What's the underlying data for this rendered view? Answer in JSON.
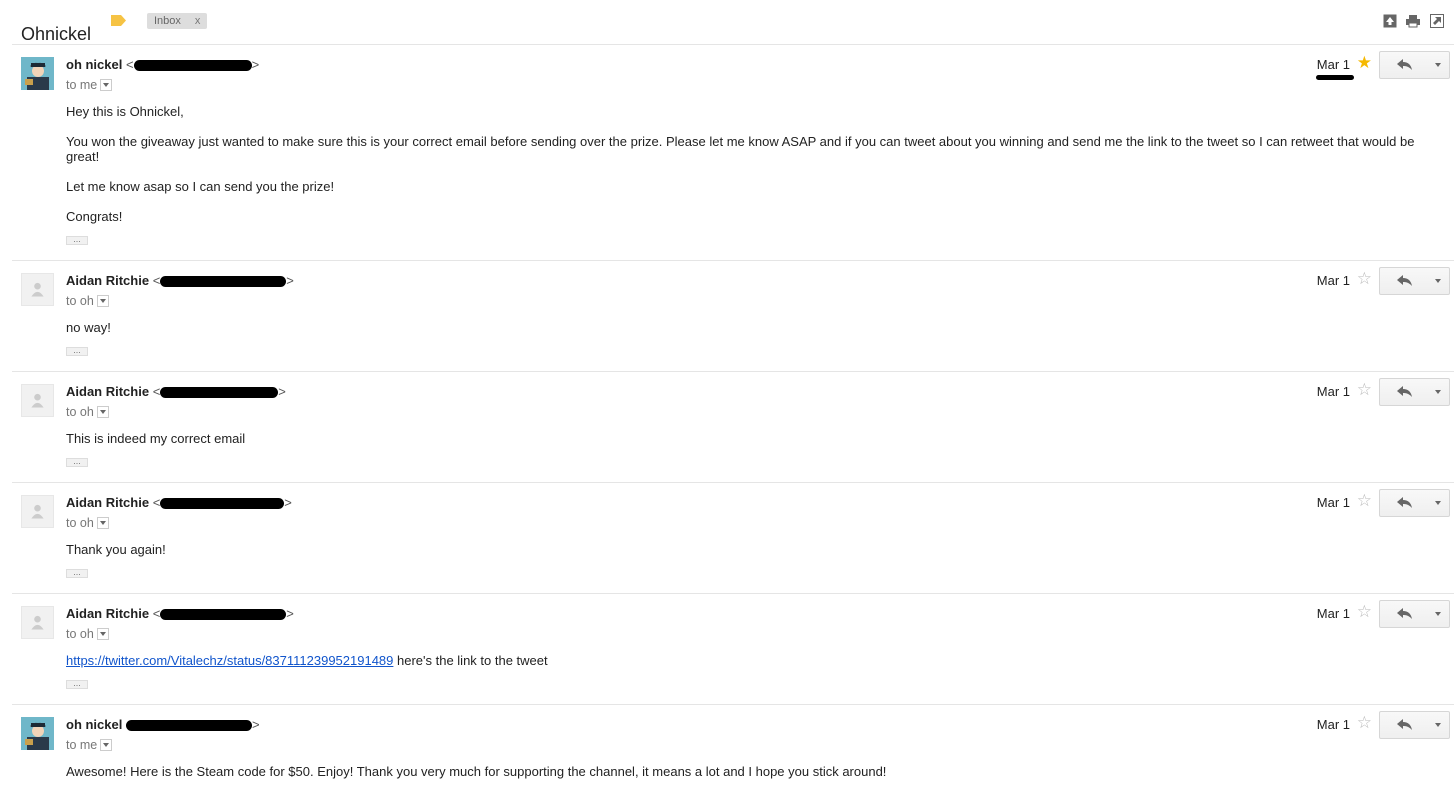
{
  "thread": {
    "subject": "Ohnickel",
    "label_chip": "Inbox",
    "label_chip_remove": "x"
  },
  "toolbar": {
    "icons": [
      "expand-all-icon",
      "print-icon",
      "new-window-icon"
    ]
  },
  "colors": {
    "star_on": "#f5b800",
    "link": "#1155cc",
    "label_tag": "#f6c344"
  },
  "messages": [
    {
      "sender": "oh nickel",
      "addr_open": "<",
      "addr_close": ">",
      "to": "to me",
      "date": "Mar 1",
      "starred": true,
      "body": [
        "Hey this is Ohnickel,",
        "You won the giveaway just wanted to make sure this is your correct email before sending over the prize. Please let me know ASAP and if you can tweet about you winning and send me the link to the tweet so I can retweet that would be great!",
        "Let me know asap so I can send you the prize!",
        "Congrats!"
      ]
    },
    {
      "sender": "Aidan Ritchie",
      "addr_open": "<",
      "addr_close": ">",
      "to": "to oh",
      "date": "Mar 1",
      "starred": false,
      "body": [
        "no way!"
      ]
    },
    {
      "sender": "Aidan Ritchie",
      "addr_open": "<",
      "addr_close": ">",
      "to": "to oh",
      "date": "Mar 1",
      "starred": false,
      "body": [
        "This is indeed my correct email"
      ]
    },
    {
      "sender": "Aidan Ritchie",
      "addr_open": "<",
      "addr_close": ">",
      "to": "to oh",
      "date": "Mar 1",
      "starred": false,
      "body": [
        "Thank you again!"
      ]
    },
    {
      "sender": "Aidan Ritchie",
      "addr_open": "<",
      "addr_close": ">",
      "to": "to oh",
      "date": "Mar 1",
      "starred": false,
      "link": "https://twitter.com/Vitalechz/status/837111239952191489",
      "link_suffix": " here's the link to the tweet"
    },
    {
      "sender": "oh nickel",
      "addr_open": "",
      "addr_close": ">",
      "to": "to me",
      "date": "Mar 1",
      "starred": false,
      "body": [
        "Awesome! Here is the Steam code for $50. Enjoy! Thank you very much for supporting the channel, it means a lot and I hope you stick around!"
      ]
    }
  ],
  "ellipsis": "..."
}
